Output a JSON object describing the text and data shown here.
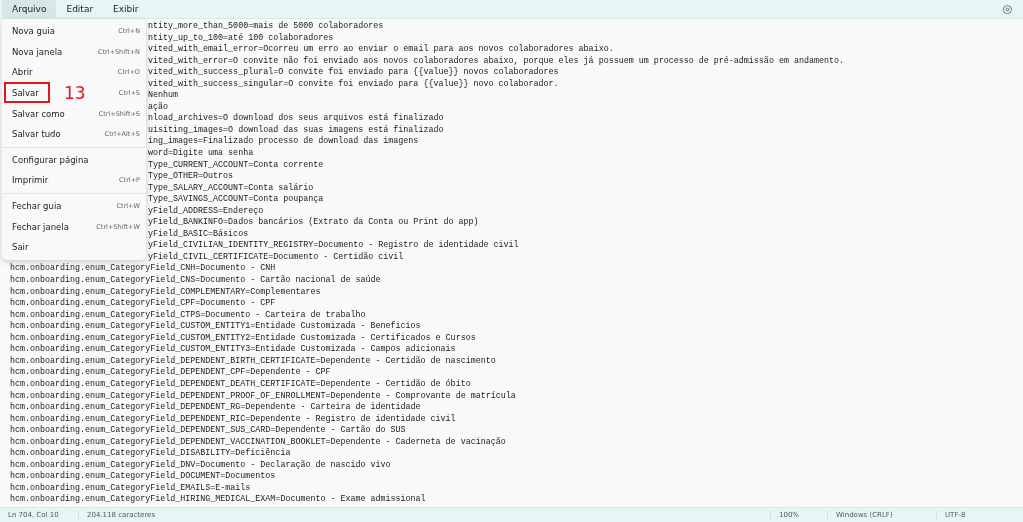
{
  "menubar": [
    {
      "label": "Arquivo",
      "selected": true
    },
    {
      "label": "Editar",
      "selected": false
    },
    {
      "label": "Exibir",
      "selected": false
    }
  ],
  "menu": {
    "groups": [
      [
        {
          "label": "Nova guia",
          "shortcut": "Ctrl+N"
        },
        {
          "label": "Nova janela",
          "shortcut": "Ctrl+Shift+N"
        },
        {
          "label": "Abrir",
          "shortcut": "Ctrl+O"
        },
        {
          "label": "Salvar",
          "shortcut": "Ctrl+S",
          "annotation": "13"
        },
        {
          "label": "Salvar como",
          "shortcut": "Ctrl+Shift+S"
        },
        {
          "label": "Salvar tudo",
          "shortcut": "Ctrl+Alt+S"
        }
      ],
      [
        {
          "label": "Configurar página"
        },
        {
          "label": "Imprimir",
          "shortcut": "Ctrl+P"
        }
      ],
      [
        {
          "label": "Fechar guia",
          "shortcut": "Ctrl+W"
        },
        {
          "label": "Fechar janela",
          "shortcut": "Ctrl+Shift+W"
        },
        {
          "label": "Sair"
        }
      ]
    ]
  },
  "lines": [
    {
      "text": "ntity_more_than_5000=mais de 5000 colaboradores",
      "clipped": true
    },
    {
      "text": "ntity_up_to_100=até 100 colaboradores",
      "clipped": true
    },
    {
      "text": "vited_with_email_error=Ocorreu um erro ao enviar o email para aos novos colaboradores abaixo.",
      "clipped": true
    },
    {
      "text": "vited_with_error=O convite não foi enviado aos novos colaboradores abaixo, porque eles já possuem um processo de pré-admissão em andamento.",
      "clipped": true
    },
    {
      "text": "vited_with_success_plural=O convite foi enviado para {{value}} novos colaboradores",
      "clipped": true
    },
    {
      "text": "vited_with_success_singular=O convite foi enviado para {{value}} novo colaborador.",
      "clipped": true
    },
    {
      "text": "Nenhum",
      "clipped": true
    },
    {
      "text": "ação",
      "clipped": true
    },
    {
      "text": "nload_archives=O download dos seus arquivos está finalizado",
      "clipped": true
    },
    {
      "text": "uisiting_images=O download das suas imagens está finalizado",
      "clipped": true
    },
    {
      "text": "ing_images=Finalizado processo de download das imagens",
      "clipped": true
    },
    {
      "text": "word=Digite uma senha",
      "clipped": true
    },
    {
      "text": "Type_CURRENT_ACCOUNT=Conta corrente",
      "clipped": true
    },
    {
      "text": "Type_OTHER=Outros",
      "clipped": true
    },
    {
      "text": "Type_SALARY_ACCOUNT=Conta salário",
      "clipped": true
    },
    {
      "text": "Type_SAVINGS_ACCOUNT=Conta poupança",
      "clipped": true
    },
    {
      "text": "yField_ADDRESS=Endereço",
      "clipped": true
    },
    {
      "text": "yField_BANKINFO=Dados bancários (Extrato da Conta ou Print do app)",
      "clipped": true
    },
    {
      "text": "yField_BASIC=Básicos",
      "clipped": true
    },
    {
      "text": "yField_CIVILIAN_IDENTITY_REGISTRY=Documento - Registro de identidade civil",
      "clipped": true
    },
    {
      "text": "yField_CIVIL_CERTIFICATE=Documento - Certidão civil",
      "clipped": true
    },
    {
      "text": "hcm.onboarding.enum_CategoryField_CNH=Documento - CNH",
      "clipped": false
    },
    {
      "text": "hcm.onboarding.enum_CategoryField_CNS=Documento - Cartão nacional de saúde",
      "clipped": false
    },
    {
      "text": "hcm.onboarding.enum_CategoryField_COMPLEMENTARY=Complementares",
      "clipped": false
    },
    {
      "text": "hcm.onboarding.enum_CategoryField_CPF=Documento - CPF",
      "clipped": false
    },
    {
      "text": "hcm.onboarding.enum_CategoryField_CTPS=Documento - Carteira de trabalho",
      "clipped": false
    },
    {
      "text": "hcm.onboarding.enum_CategoryField_CUSTOM_ENTITY1=Entidade Customizada - Beneficios",
      "clipped": false
    },
    {
      "text": "hcm.onboarding.enum_CategoryField_CUSTOM_ENTITY2=Entidade Customizada - Certificados e Cursos",
      "clipped": false
    },
    {
      "text": "hcm.onboarding.enum_CategoryField_CUSTOM_ENTITY3=Entidade Customizada - Campos adicionais",
      "clipped": false
    },
    {
      "text": "hcm.onboarding.enum_CategoryField_DEPENDENT_BIRTH_CERTIFICATE=Dependente - Certidão de nascimento",
      "clipped": false
    },
    {
      "text": "hcm.onboarding.enum_CategoryField_DEPENDENT_CPF=Dependente - CPF",
      "clipped": false
    },
    {
      "text": "hcm.onboarding.enum_CategoryField_DEPENDENT_DEATH_CERTIFICATE=Dependente - Certidão de óbito",
      "clipped": false
    },
    {
      "text": "hcm.onboarding.enum_CategoryField_DEPENDENT_PROOF_OF_ENROLLMENT=Dependente - Comprovante de matrícula",
      "clipped": false
    },
    {
      "text": "hcm.onboarding.enum_CategoryField_DEPENDENT_RG=Dependente - Carteira de identidade",
      "clipped": false
    },
    {
      "text": "hcm.onboarding.enum_CategoryField_DEPENDENT_RIC=Dependente - Registro de identidade civil",
      "clipped": false
    },
    {
      "text": "hcm.onboarding.enum_CategoryField_DEPENDENT_SUS_CARD=Dependente - Cartão do SUS",
      "clipped": false
    },
    {
      "text": "hcm.onboarding.enum_CategoryField_DEPENDENT_VACCINATION_BOOKLET=Dependente - Caderneta de vacinação",
      "clipped": false
    },
    {
      "text": "hcm.onboarding.enum_CategoryField_DISABILITY=Deficiência",
      "clipped": false
    },
    {
      "text": "hcm.onboarding.enum_CategoryField_DNV=Documento - Declaração de nascido vivo",
      "clipped": false
    },
    {
      "text": "hcm.onboarding.enum_CategoryField_DOCUMENT=Documentos",
      "clipped": false
    },
    {
      "text": "hcm.onboarding.enum_CategoryField_EMAILS=E-mails",
      "clipped": false
    },
    {
      "text": "hcm.onboarding.enum_CategoryField_HIRING_MEDICAL_EXAM=Documento - Exame admissional",
      "clipped": false
    }
  ],
  "status_bar": {
    "position": "Ln 704, Col 10",
    "characters": "204.118 caracteres",
    "zoom": "100%",
    "line_ending": "Windows (CRLF)",
    "encoding": "UTF-8"
  }
}
